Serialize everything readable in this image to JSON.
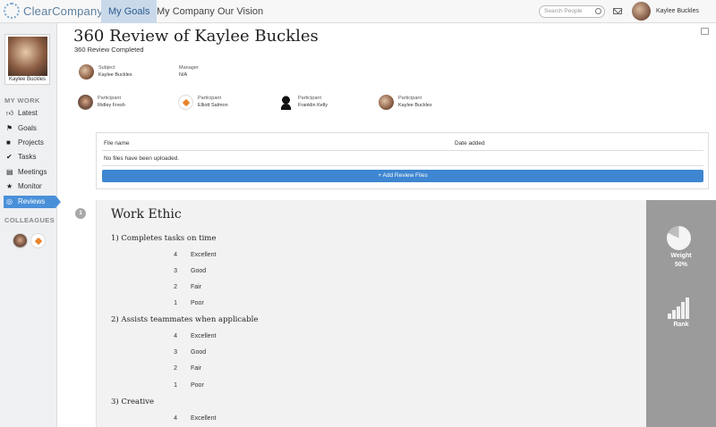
{
  "app": {
    "logo": "ClearCompany"
  },
  "nav": {
    "tabs": [
      "My Goals",
      "My Company",
      "Our Vision"
    ],
    "active": "My Goals"
  },
  "search": {
    "placeholder": "Search People"
  },
  "user": {
    "name": "Kaylee Buckles"
  },
  "sidebar": {
    "profile_name": "Kaylee Buckles",
    "my_work_title": "MY WORK",
    "items": [
      {
        "label": "Latest",
        "icon": "thumbs-up-icon"
      },
      {
        "label": "Goals",
        "icon": "flag-icon"
      },
      {
        "label": "Projects",
        "icon": "briefcase-icon"
      },
      {
        "label": "Tasks",
        "icon": "check-circle-icon"
      },
      {
        "label": "Meetings",
        "icon": "list-icon"
      },
      {
        "label": "Monitor",
        "icon": "star-icon"
      },
      {
        "label": "Reviews",
        "icon": "refresh-circle-icon"
      }
    ],
    "active_item": "Reviews",
    "colleagues_title": "COLLEAGUES"
  },
  "review": {
    "title": "360 Review of Kaylee Buckles",
    "status": "360 Review Completed",
    "subject": {
      "role": "Subject",
      "name": "Kaylee Buckles"
    },
    "manager": {
      "role": "Manager",
      "name": "N/A"
    },
    "participants": [
      {
        "role": "Participant",
        "name": "Ridley Fresh"
      },
      {
        "role": "Participant",
        "name": "Elliott Salmon"
      },
      {
        "role": "Participant",
        "name": "Franklin Kelly"
      },
      {
        "role": "Participant",
        "name": "Kaylee Buckles"
      }
    ]
  },
  "files": {
    "col_file_name": "File name",
    "col_date_added": "Date added",
    "empty_message": "No files have been uploaded.",
    "add_button": "+ Add Review Files"
  },
  "section": {
    "number": "1",
    "title": "Work Ethic",
    "weight_label": "Weight",
    "weight_value": "50%",
    "rank_label": "Rank",
    "questions": [
      {
        "text": "1) Completes tasks on time",
        "options": [
          {
            "value": "4",
            "label": "Excellent"
          },
          {
            "value": "3",
            "label": "Good"
          },
          {
            "value": "2",
            "label": "Fair"
          },
          {
            "value": "1",
            "label": "Poor"
          }
        ]
      },
      {
        "text": "2) Assists teammates when applicable",
        "options": [
          {
            "value": "4",
            "label": "Excellent"
          },
          {
            "value": "3",
            "label": "Good"
          },
          {
            "value": "2",
            "label": "Fair"
          },
          {
            "value": "1",
            "label": "Poor"
          }
        ]
      },
      {
        "text": "3) Creative",
        "options": [
          {
            "value": "4",
            "label": "Excellent"
          }
        ]
      }
    ]
  },
  "colors": {
    "accent": "#4a90d9",
    "button": "#3e86d1",
    "side_panel": "#9b9b9b"
  }
}
